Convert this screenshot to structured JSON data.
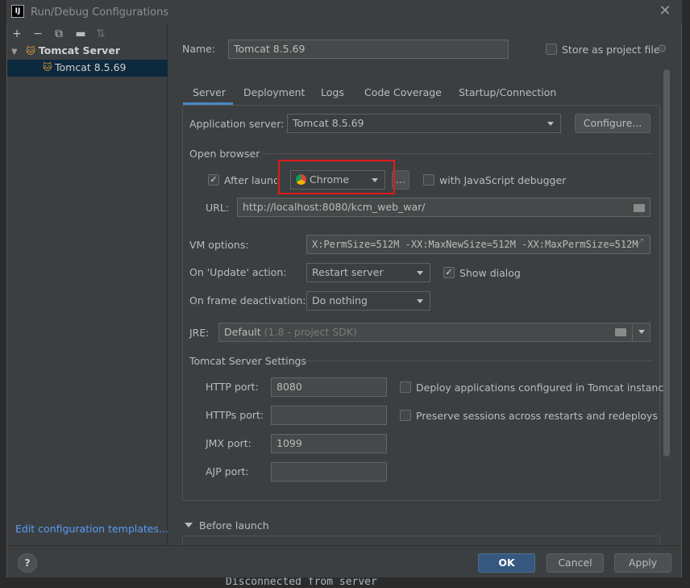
{
  "window": {
    "title": "Run/Debug Configurations",
    "icon_text": "IJ"
  },
  "left_toolbar": {
    "add_icon": "plus-icon",
    "remove_icon": "minus-icon",
    "copy_icon": "copy-icon",
    "folder_icon": "new-folder-icon",
    "sort_icon": "sort-icon"
  },
  "tree": {
    "root": "Tomcat Server",
    "child": "Tomcat 8.5.69"
  },
  "edit_templates": "Edit configuration templates...",
  "name_label": "Name:",
  "name_value": "Tomcat 8.5.69",
  "store_project_file": "Store as project file",
  "tabs": [
    "Server",
    "Deployment",
    "Logs",
    "Code Coverage",
    "Startup/Connection"
  ],
  "server": {
    "app_server_label": "Application server:",
    "app_server_value": "Tomcat 8.5.69",
    "configure_btn": "Configure...",
    "open_browser_title": "Open browser",
    "after_launch_label": "After launch",
    "after_launch_checked": true,
    "browser_value": "Chrome",
    "browse_btn": "...",
    "js_debugger_label": "with JavaScript debugger",
    "js_debugger_checked": false,
    "url_label": "URL:",
    "url_value": "http://localhost:8080/kcm_web_war/",
    "vm_label": "VM options:",
    "vm_value": "X:PermSize=512M -XX:MaxNewSize=512M -XX:MaxPermSize=512M",
    "update_label": "On 'Update' action:",
    "update_value": "Restart server",
    "show_dialog_label": "Show dialog",
    "show_dialog_checked": true,
    "frame_label": "On frame deactivation:",
    "frame_value": "Do nothing",
    "jre_label": "JRE:",
    "jre_value": "Default",
    "jre_hint": "(1.8 - project SDK)",
    "tomcat_settings_title": "Tomcat Server Settings",
    "http_port_label": "HTTP port:",
    "http_port_value": "8080",
    "https_port_label": "HTTPs port:",
    "https_port_value": "",
    "jmx_port_label": "JMX port:",
    "jmx_port_value": "1099",
    "ajp_port_label": "AJP port:",
    "ajp_port_value": "",
    "deploy_label": "Deploy applications configured in Tomcat instance",
    "preserve_label": "Preserve sessions across restarts and redeploys"
  },
  "before_launch": "Before launch",
  "buttons": {
    "help": "?",
    "ok": "OK",
    "cancel": "Cancel",
    "apply": "Apply"
  },
  "background_console": "Disconnected from server",
  "colors": {
    "accent": "#4a88c7",
    "highlight_box": "#e21b1b",
    "ok_button": "#365880",
    "link": "#589df6"
  }
}
